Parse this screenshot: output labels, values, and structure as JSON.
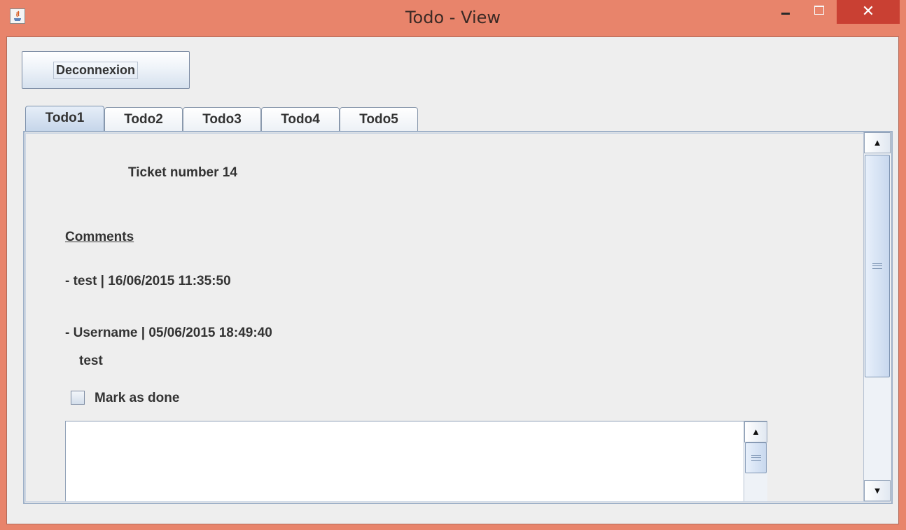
{
  "window": {
    "title": "Todo - View",
    "close_glyph": "✕",
    "icons": [
      "java-app-icon",
      "minimize-icon",
      "maximize-icon",
      "close-icon"
    ],
    "accent_color": "#e8846b"
  },
  "toolbar": {
    "deconnexion_label": "Deconnexion"
  },
  "tabs": [
    {
      "label": "Todo1",
      "active": true
    },
    {
      "label": "Todo2",
      "active": false
    },
    {
      "label": "Todo3",
      "active": false
    },
    {
      "label": "Todo4",
      "active": false
    },
    {
      "label": "Todo5",
      "active": false
    }
  ],
  "ticket": {
    "title": "Ticket number 14",
    "comments_heading": "Comments",
    "comments": [
      {
        "header": "- test | 16/06/2015 11:35:50",
        "body": ""
      },
      {
        "header": "- Username | 05/06/2015 18:49:40",
        "body": "test"
      }
    ],
    "mark_done_label": "Mark as done",
    "mark_done_checked": false,
    "new_comment_value": ""
  },
  "scrollbars": {
    "up_glyph": "▲",
    "down_glyph": "▼"
  }
}
